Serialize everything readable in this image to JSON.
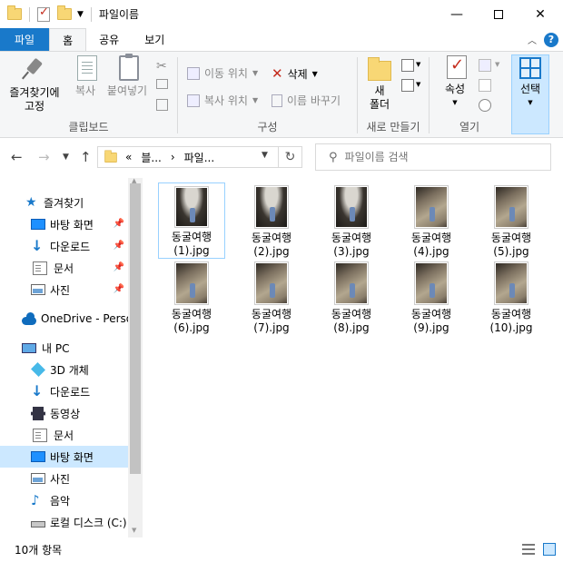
{
  "window": {
    "title": "파일이름",
    "minimize_glyph": "—",
    "close_glyph": "✕"
  },
  "ribbon": {
    "tabs": [
      {
        "label": "파일"
      },
      {
        "label": "홈"
      },
      {
        "label": "공유"
      },
      {
        "label": "보기"
      }
    ],
    "groups": {
      "clipboard": {
        "label": "클립보드",
        "pin_label_line1": "즐겨찾기에",
        "pin_label_line2": "고정",
        "copy_label": "복사",
        "paste_label": "붙여넣기"
      },
      "organize": {
        "label": "구성",
        "move_to_label": "이동 위치",
        "copy_to_label": "복사 위치",
        "delete_label": "삭제",
        "rename_label": "이름 바꾸기"
      },
      "new": {
        "label": "새로 만들기",
        "new_folder_line1": "새",
        "new_folder_line2": "폴더"
      },
      "open": {
        "label": "열기",
        "properties_label": "속성"
      },
      "select": {
        "select_label": "선택"
      }
    }
  },
  "address": {
    "overflow": "«",
    "segment1": "블...",
    "segment2": "파일...",
    "chevron": "›"
  },
  "search": {
    "placeholder": "파일이름 검색"
  },
  "nav": {
    "items": [
      {
        "label": "즐겨찾기",
        "icon": "star-icon"
      },
      {
        "label": "바탕 화면",
        "icon": "desktop-icon",
        "pinned": true
      },
      {
        "label": "다운로드",
        "icon": "download-icon",
        "pinned": true
      },
      {
        "label": "문서",
        "icon": "documents-icon",
        "pinned": true
      },
      {
        "label": "사진",
        "icon": "pictures-icon",
        "pinned": true
      },
      {
        "label": "OneDrive - Person",
        "icon": "onedrive-icon"
      },
      {
        "label": "내 PC",
        "icon": "this-pc-icon"
      },
      {
        "label": "3D 개체",
        "icon": "3d-objects-icon"
      },
      {
        "label": "다운로드",
        "icon": "download-icon"
      },
      {
        "label": "동영상",
        "icon": "videos-icon"
      },
      {
        "label": "문서",
        "icon": "documents-icon"
      },
      {
        "label": "바탕 화면",
        "icon": "desktop-icon",
        "selected": true
      },
      {
        "label": "사진",
        "icon": "pictures-icon"
      },
      {
        "label": "음악",
        "icon": "music-icon"
      },
      {
        "label": "로컬 디스크 (C:)",
        "icon": "local-disk-icon"
      }
    ]
  },
  "files": [
    {
      "name_line1": "동굴여행",
      "name_line2": "(1).jpg",
      "tone": "dark"
    },
    {
      "name_line1": "동굴여행",
      "name_line2": "(2).jpg",
      "tone": "dark"
    },
    {
      "name_line1": "동굴여행",
      "name_line2": "(3).jpg",
      "tone": "dark"
    },
    {
      "name_line1": "동굴여행",
      "name_line2": "(4).jpg",
      "tone": "light"
    },
    {
      "name_line1": "동굴여행",
      "name_line2": "(5).jpg",
      "tone": "light"
    },
    {
      "name_line1": "동굴여행",
      "name_line2": "(6).jpg",
      "tone": "light"
    },
    {
      "name_line1": "동굴여행",
      "name_line2": "(7).jpg",
      "tone": "light"
    },
    {
      "name_line1": "동굴여행",
      "name_line2": "(8).jpg",
      "tone": "light"
    },
    {
      "name_line1": "동굴여행",
      "name_line2": "(9).jpg",
      "tone": "light"
    },
    {
      "name_line1": "동굴여행",
      "name_line2": "(10).jpg",
      "tone": "light"
    }
  ],
  "status": {
    "item_count": "10개 항목"
  },
  "colors": {
    "accent": "#1979ca",
    "selection": "#cce8ff",
    "folder": "#f8d775"
  }
}
